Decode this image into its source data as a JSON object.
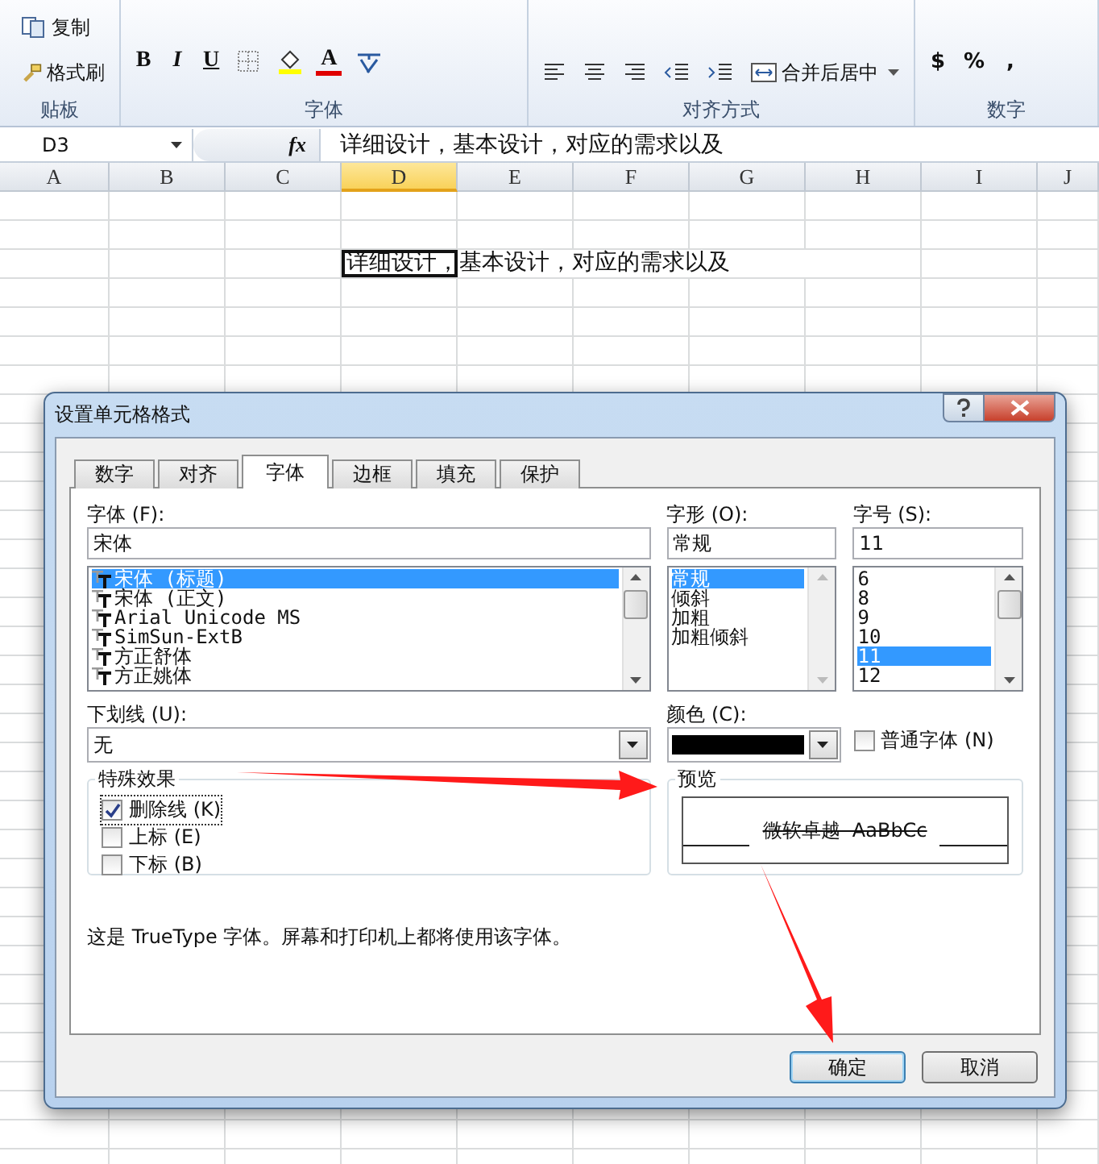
{
  "ribbon": {
    "groups": [
      {
        "label": "贴板",
        "items": [
          {
            "kind": "copy",
            "label": "复制"
          },
          {
            "kind": "painter",
            "label": "格式刷"
          }
        ]
      },
      {
        "label": "字体",
        "items": [
          {
            "kind": "bold",
            "label": "B"
          },
          {
            "kind": "italic",
            "label": "I"
          },
          {
            "kind": "underline",
            "label": "U"
          },
          {
            "kind": "borders"
          },
          {
            "kind": "fill-color"
          },
          {
            "kind": "font-color",
            "label": "A"
          },
          {
            "kind": "phonetic"
          }
        ]
      },
      {
        "label": "对齐方式",
        "items": [
          {
            "kind": "align-left"
          },
          {
            "kind": "align-center"
          },
          {
            "kind": "align-right"
          },
          {
            "kind": "outdent"
          },
          {
            "kind": "indent"
          },
          {
            "kind": "merge",
            "label": "合并后居中"
          }
        ]
      },
      {
        "label": "数字",
        "items": [
          {
            "kind": "currency",
            "label": "$"
          },
          {
            "kind": "percent",
            "label": "%"
          },
          {
            "kind": "comma",
            "label": ","
          }
        ]
      }
    ]
  },
  "formula_bar": {
    "name_box": "D3",
    "function_label": "fx",
    "content": "详细设计，基本设计，对应的需求以及"
  },
  "sheet": {
    "columns": [
      {
        "label": "A",
        "selected": false
      },
      {
        "label": "B",
        "selected": false
      },
      {
        "label": "C",
        "selected": false
      },
      {
        "label": "D",
        "selected": true
      },
      {
        "label": "E",
        "selected": false
      },
      {
        "label": "F",
        "selected": false
      },
      {
        "label": "G",
        "selected": false
      },
      {
        "label": "H",
        "selected": false
      },
      {
        "label": "I",
        "selected": false
      },
      {
        "label": "J",
        "selected": false
      }
    ],
    "active_cell_text": "详细设计，基本设计，对应的需求以及"
  },
  "dialog": {
    "title": "设置单元格格式",
    "tabs": [
      {
        "label": "数字",
        "selected": false
      },
      {
        "label": "对齐",
        "selected": false
      },
      {
        "label": "字体",
        "selected": true
      },
      {
        "label": "边框",
        "selected": false
      },
      {
        "label": "填充",
        "selected": false
      },
      {
        "label": "保护",
        "selected": false
      }
    ],
    "font": {
      "label": "字体 (F):",
      "value": "宋体",
      "items": [
        {
          "label": "宋体 (标题)",
          "selected": true
        },
        {
          "label": "宋体 (正文)",
          "selected": false
        },
        {
          "label": "Arial Unicode MS",
          "selected": false
        },
        {
          "label": "SimSun-ExtB",
          "selected": false
        },
        {
          "label": "方正舒体",
          "selected": false
        },
        {
          "label": "方正姚体",
          "selected": false
        }
      ]
    },
    "style": {
      "label": "字形 (O):",
      "value": "常规",
      "items": [
        {
          "label": "常规",
          "selected": true
        },
        {
          "label": "倾斜",
          "selected": false
        },
        {
          "label": "加粗",
          "selected": false
        },
        {
          "label": "加粗倾斜",
          "selected": false
        }
      ]
    },
    "size": {
      "label": "字号 (S):",
      "value": "11",
      "items": [
        {
          "label": "6",
          "selected": false
        },
        {
          "label": "8",
          "selected": false
        },
        {
          "label": "9",
          "selected": false
        },
        {
          "label": "10",
          "selected": false
        },
        {
          "label": "11",
          "selected": true
        },
        {
          "label": "12",
          "selected": false
        }
      ]
    },
    "underline": {
      "label": "下划线 (U):",
      "value": "无"
    },
    "color": {
      "label": "颜色 (C):",
      "color": "#000000"
    },
    "normal_font": {
      "label": "普通字体 (N)",
      "checked": false
    },
    "effects": {
      "legend": "特殊效果",
      "items": [
        {
          "label": "删除线 (K)",
          "checked": true
        },
        {
          "label": "上标 (E)",
          "checked": false
        },
        {
          "label": "下标 (B)",
          "checked": false
        }
      ]
    },
    "preview": {
      "legend": "预览",
      "text": "微软卓越  AaBbCc",
      "strikethrough": true
    },
    "info": "这是 TrueType 字体。屏幕和打印机上都将使用该字体。",
    "buttons": [
      {
        "label": "确定",
        "default": true
      },
      {
        "label": "取消",
        "default": false
      }
    ]
  }
}
